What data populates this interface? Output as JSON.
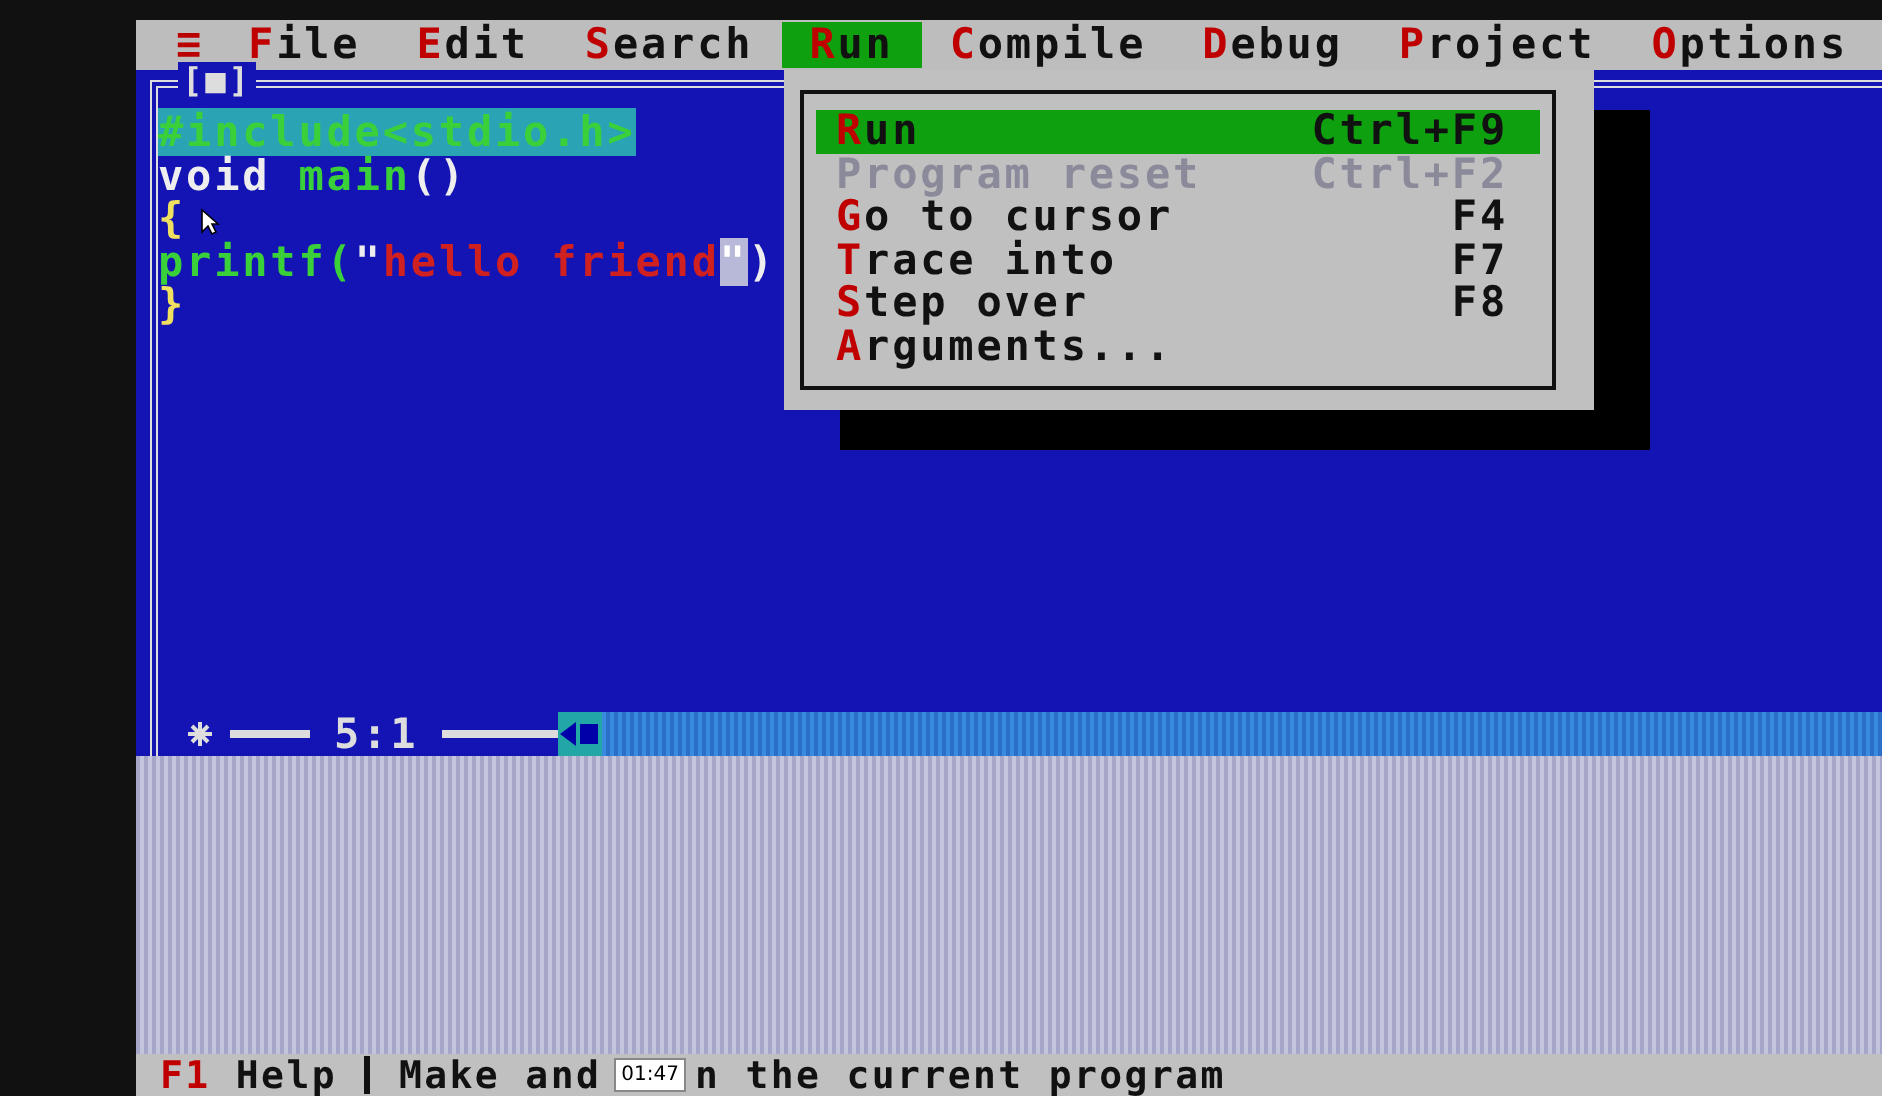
{
  "menu_bar": [
    {
      "label": "≡",
      "kind": "system",
      "selected": false
    },
    {
      "label": "File",
      "kind": "menu",
      "selected": false
    },
    {
      "label": "Edit",
      "kind": "menu",
      "selected": false
    },
    {
      "label": "Search",
      "kind": "menu",
      "selected": false
    },
    {
      "label": "Run",
      "kind": "menu",
      "selected": true
    },
    {
      "label": "Compile",
      "kind": "menu",
      "selected": false
    },
    {
      "label": "Debug",
      "kind": "menu",
      "selected": false
    },
    {
      "label": "Project",
      "kind": "menu",
      "selected": false
    },
    {
      "label": "Options",
      "kind": "menu",
      "selected": false
    }
  ],
  "editor": {
    "close_box": "[■]",
    "lines": [
      [
        {
          "text": "#include<stdio.h>",
          "kind": "block"
        }
      ],
      [
        {
          "text": "void",
          "kind": "plain"
        },
        {
          "text": " main",
          "kind": "ident"
        },
        {
          "text": "()",
          "kind": "plain"
        }
      ],
      [
        {
          "text": "{",
          "kind": "yellow"
        }
      ],
      [
        {
          "text": "printf(",
          "kind": "ident"
        },
        {
          "text": "\"",
          "kind": "plain"
        },
        {
          "text": "hello friend",
          "kind": "string"
        },
        {
          "text": "\"",
          "kind": "mark"
        },
        {
          "text": ")",
          "kind": "plain"
        }
      ],
      [
        {
          "text": "}",
          "kind": "yellow"
        }
      ]
    ],
    "position": "5:1"
  },
  "run_menu": [
    {
      "label": "Run",
      "shortcut": "Ctrl+F9",
      "selected": true,
      "disabled": false
    },
    {
      "label": "Program reset",
      "shortcut": "Ctrl+F2",
      "selected": false,
      "disabled": true
    },
    {
      "label": "Go to cursor",
      "shortcut": "F4",
      "selected": false,
      "disabled": false
    },
    {
      "label": "Trace into",
      "shortcut": "F7",
      "selected": false,
      "disabled": false
    },
    {
      "label": "Step over",
      "shortcut": "F8",
      "selected": false,
      "disabled": false
    },
    {
      "label": "Arguments...",
      "selected": false,
      "disabled": false
    }
  ],
  "status_bar": {
    "key": "F1",
    "key_label": "Help",
    "message_start": "Make and",
    "message_end": "n the current program",
    "video_time": "01:47"
  }
}
